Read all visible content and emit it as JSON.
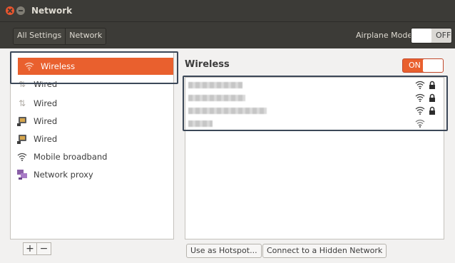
{
  "window": {
    "title": "Network"
  },
  "toolbar": {
    "breadcrumbs": [
      "All Settings",
      "Network"
    ],
    "airplane_mode_label": "Airplane Mode",
    "airplane_mode_state": "OFF"
  },
  "sidebar": {
    "items": [
      {
        "label": "Wireless",
        "icon": "wifi-icon",
        "selected": true
      },
      {
        "label": "Wired",
        "icon": "wired-arrows-icon"
      },
      {
        "label": "Wired",
        "icon": "wired-arrows-icon"
      },
      {
        "label": "Wired",
        "icon": "wired-device-icon"
      },
      {
        "label": "Wired",
        "icon": "wired-device-icon"
      },
      {
        "label": "Mobile broadband",
        "icon": "mobile-broadband-icon"
      },
      {
        "label": "Network proxy",
        "icon": "network-proxy-icon"
      }
    ],
    "add_label": "+",
    "remove_label": "−"
  },
  "wireless": {
    "title": "Wireless",
    "toggle_state": "ON",
    "networks": [
      {
        "name_hidden": true,
        "icon": "wifi-signal-icon",
        "secured": true
      },
      {
        "name_hidden": true,
        "icon": "wifi-signal-icon",
        "secured": true
      },
      {
        "name_hidden": true,
        "icon": "wifi-signal-icon",
        "secured": true
      },
      {
        "name_hidden": true,
        "icon": "wifi-signal-icon",
        "secured": false
      }
    ],
    "use_as_hotspot_label": "Use as Hotspot...",
    "connect_hidden_label": "Connect to a Hidden Network"
  },
  "colors": {
    "accent": "#e9602e",
    "titlebar": "#3c3b37",
    "highlight_frame": "#3c4858"
  }
}
